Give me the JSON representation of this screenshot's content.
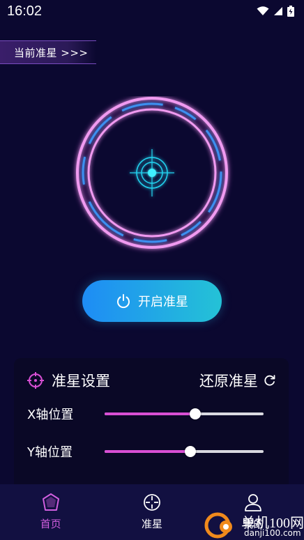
{
  "status_bar": {
    "time": "16:02",
    "icons": [
      "wifi-icon",
      "signal-icon",
      "battery-charging-icon"
    ]
  },
  "current_crosshair_tag": "当前准星 >>>",
  "start_button": {
    "label": "开启准星",
    "icon": "power-icon"
  },
  "settings": {
    "title": "准星设置",
    "title_icon": "crosshair-icon",
    "reset_label": "还原准星",
    "reset_icon": "refresh-icon",
    "sliders": [
      {
        "label": "X轴位置",
        "value": 0.57
      },
      {
        "label": "Y轴位置",
        "value": 0.54
      }
    ]
  },
  "bottom_nav": {
    "items": [
      {
        "label": "首页",
        "icon": "home-icon",
        "active": true
      },
      {
        "label": "准星",
        "icon": "crosshair-icon",
        "active": false
      },
      {
        "label": "我的",
        "icon": "user-icon",
        "active": false
      }
    ]
  },
  "watermark": {
    "cn": "单机100网",
    "en": "danji100.com"
  },
  "colors": {
    "background": "#0b0830",
    "accent_pink": "#d84fd4",
    "accent_cyan": "#22d3f0",
    "button_start": "#1e8cf5",
    "button_end": "#24c2d6",
    "nav_background": "#121041",
    "nav_active": "#d25fe0"
  }
}
